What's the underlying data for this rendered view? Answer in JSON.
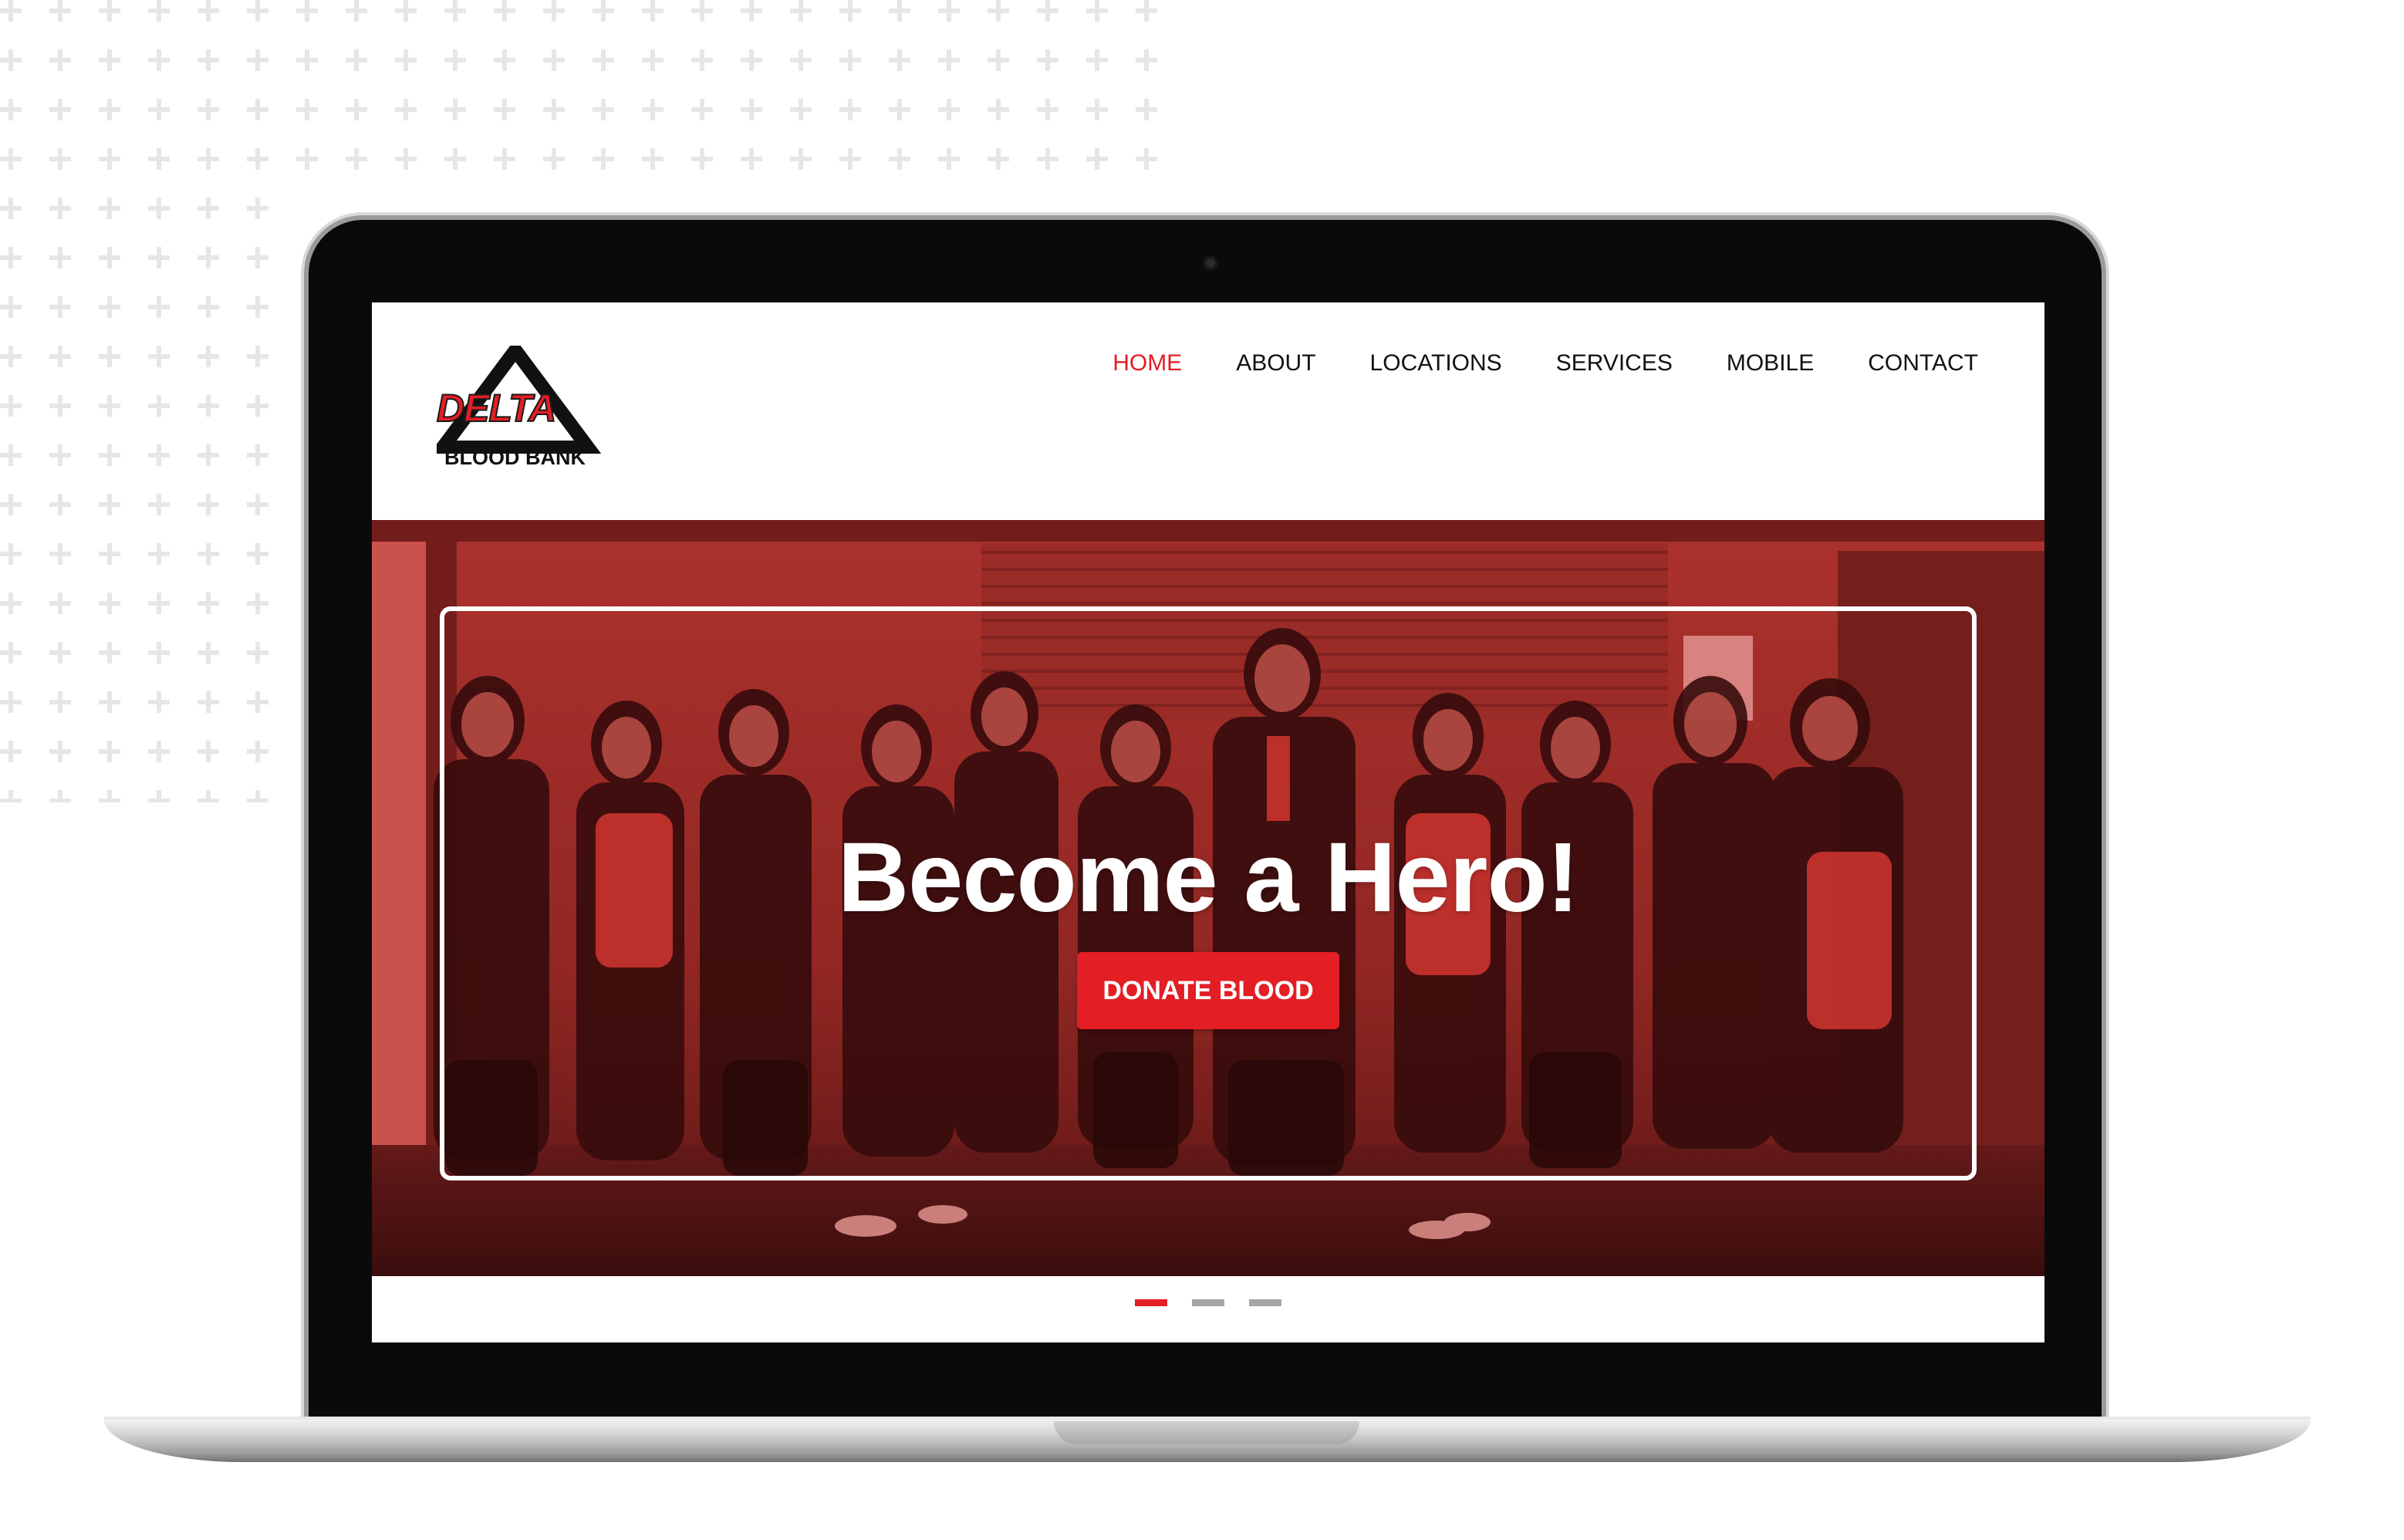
{
  "logo": {
    "name": "DELTA",
    "tagline": "BLOOD BANK"
  },
  "nav": {
    "items": [
      {
        "label": "HOME",
        "active": true
      },
      {
        "label": "ABOUT",
        "active": false
      },
      {
        "label": "LOCATIONS",
        "active": false
      },
      {
        "label": "SERVICES",
        "active": false
      },
      {
        "label": "MOBILE",
        "active": false
      },
      {
        "label": "CONTACT",
        "active": false
      }
    ]
  },
  "hero": {
    "title": "Become a Hero!",
    "button_label": "DONATE BLOOD"
  },
  "carousel": {
    "slide_count": 3,
    "active_index": 0
  },
  "colors": {
    "brand_red": "#e31e24",
    "nav_text": "#111111",
    "inactive_dot": "#a6a6a6",
    "pattern_plus": "#e6e6e6"
  }
}
